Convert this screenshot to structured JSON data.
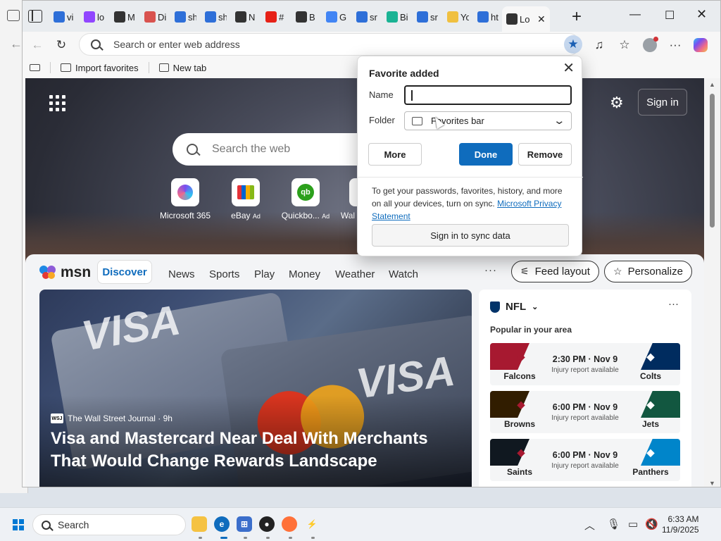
{
  "tabs": [
    {
      "title": "vi",
      "icon": "search-icon",
      "color": "#2e6fd8"
    },
    {
      "title": "lo",
      "icon": "twitch-icon",
      "color": "#9146ff"
    },
    {
      "title": "M",
      "icon": "app-icon",
      "color": "#333333"
    },
    {
      "title": "Di",
      "icon": "gmail-icon",
      "color": "#d9534f"
    },
    {
      "title": "sh",
      "icon": "search-icon",
      "color": "#2e6fd8"
    },
    {
      "title": "sh",
      "icon": "search-icon",
      "color": "#2e6fd8"
    },
    {
      "title": "N",
      "icon": "news-icon",
      "color": "#333333"
    },
    {
      "title": "#",
      "icon": "youtube-icon",
      "color": "#e62117"
    },
    {
      "title": "B",
      "icon": "app-icon",
      "color": "#333333"
    },
    {
      "title": "G",
      "icon": "google-icon",
      "color": "#4285f4"
    },
    {
      "title": "sr",
      "icon": "search-icon",
      "color": "#2e6fd8"
    },
    {
      "title": "Bi",
      "icon": "bing-icon",
      "color": "#1ab394"
    },
    {
      "title": "sr",
      "icon": "search-icon",
      "color": "#2e6fd8"
    },
    {
      "title": "Yo",
      "icon": "emoji-icon",
      "color": "#f0c040"
    },
    {
      "title": "ht",
      "icon": "search-icon",
      "color": "#2e6fd8"
    },
    {
      "title": "Lo",
      "icon": "app-icon",
      "color": "#333333",
      "active": true
    }
  ],
  "address": {
    "placeholder": "Search or enter web address"
  },
  "favbar": {
    "import": "Import favorites",
    "newtab": "New tab"
  },
  "page": {
    "search_placeholder": "Search the web",
    "signin": "Sign in",
    "quicklinks": [
      {
        "label": "Microsoft 365",
        "ad": ""
      },
      {
        "label": "eBay",
        "ad": "Ad"
      },
      {
        "label": "Quickbo...",
        "ad": "Ad"
      },
      {
        "label": "Wal",
        "ad": ""
      }
    ]
  },
  "feed": {
    "logo": "msn",
    "nav": [
      "Discover",
      "News",
      "Sports",
      "Play",
      "Money",
      "Weather",
      "Watch"
    ],
    "more": "···",
    "feed_layout": "Feed layout",
    "personalize": "Personalize",
    "hero": {
      "source": "The Wall Street Journal · 9h",
      "source_logo": "WSJ",
      "headline": "Visa and Mastercard Near Deal With Merchants That Would Change Rewards Landscape"
    },
    "nfl": {
      "title": "NFL",
      "subtitle": "Popular in your area",
      "games": [
        {
          "home": "Falcons",
          "away": "Colts",
          "time": "2:30 PM · Nov 9",
          "note": "Injury report available",
          "home_color": "#a71930",
          "away_color": "#002c5f"
        },
        {
          "home": "Browns",
          "away": "Jets",
          "time": "6:00 PM · Nov 9",
          "note": "Injury report available",
          "home_color": "#311d00",
          "away_color": "#125740"
        },
        {
          "home": "Saints",
          "away": "Panthers",
          "time": "6:00 PM · Nov 9",
          "note": "Injury report available",
          "home_color": "#101820",
          "away_color": "#0085ca"
        }
      ]
    }
  },
  "popup": {
    "title": "Favorite added",
    "name_label": "Name",
    "name_value": "",
    "folder_label": "Folder",
    "folder_value": "Favorites bar",
    "more": "More",
    "done": "Done",
    "remove": "Remove",
    "sync_text": "To get your passwords, favorites, history, and more on all your devices, turn on sync.",
    "privacy_link": "Microsoft Privacy Statement",
    "sync_button": "Sign in to sync data"
  },
  "taskbar": {
    "search": "Search",
    "time": "6:33 AM",
    "date": "11/9/2025"
  }
}
